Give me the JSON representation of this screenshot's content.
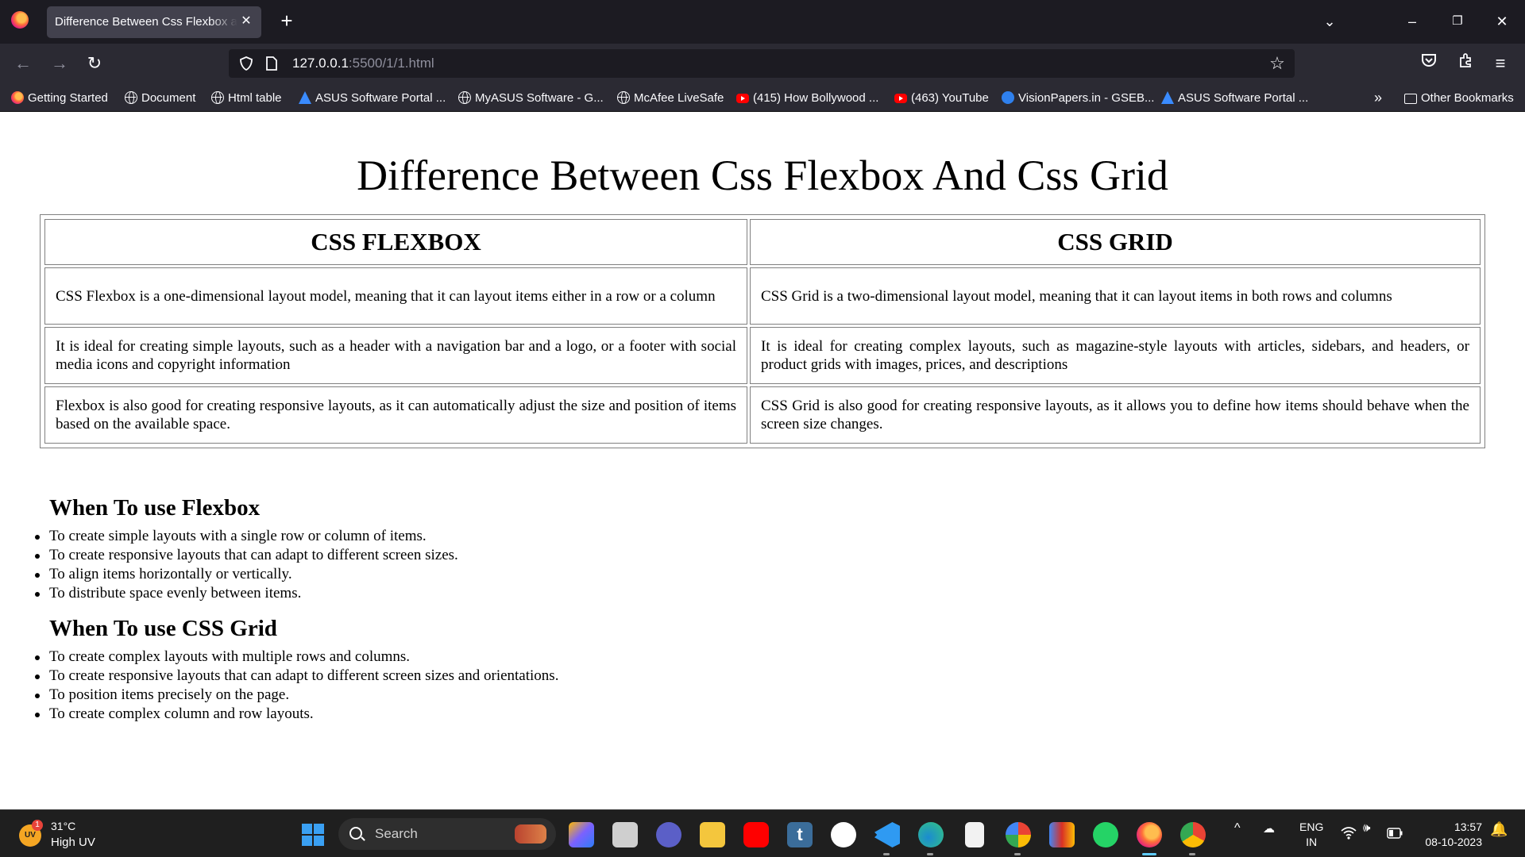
{
  "browser": {
    "tab_title": "Difference Between Css Flexbox and Css Grid",
    "url_host": "127.0.0.1",
    "url_rest": ":5500/1/1.html",
    "bookmarks": [
      {
        "label": "Getting Started",
        "icon": "firefox-icon"
      },
      {
        "label": "Document",
        "icon": "globe-icon"
      },
      {
        "label": "Html table",
        "icon": "globe-icon"
      },
      {
        "label": "ASUS Software Portal ...",
        "icon": "asus-icon"
      },
      {
        "label": "MyASUS Software - G...",
        "icon": "globe-icon"
      },
      {
        "label": "McAfee LiveSafe",
        "icon": "globe-icon"
      },
      {
        "label": "(415) How Bollywood ...",
        "icon": "youtube-icon"
      },
      {
        "label": "(463) YouTube",
        "icon": "youtube-icon"
      },
      {
        "label": "VisionPapers.in - GSEB...",
        "icon": "visionpapers-icon"
      },
      {
        "label": "ASUS Software Portal ...",
        "icon": "asus-icon"
      }
    ],
    "other_bookmarks": "Other Bookmarks"
  },
  "page": {
    "title": "Difference Between Css Flexbox And Css Grid",
    "table": {
      "headers": [
        "CSS FLEXBOX",
        "CSS GRID"
      ],
      "rows": [
        [
          "CSS Flexbox is a one-dimensional layout model, meaning that it can layout items either in a row or a column",
          "CSS Grid is a two-dimensional layout model, meaning that it can layout items in both rows and columns"
        ],
        [
          "It is ideal for creating simple layouts, such as a header with a navigation bar and a logo, or a footer with social media icons and copyright information",
          "It is ideal for creating complex layouts, such as magazine-style layouts with articles, sidebars, and headers, or product grids with images, prices, and descriptions"
        ],
        [
          "Flexbox is also good for creating responsive layouts, as it can automatically adjust the size and position of items based on the available space.",
          "CSS Grid is also good for creating responsive layouts, as it allows you to define how items should behave when the screen size changes."
        ]
      ]
    },
    "flex_section": {
      "heading": "When To use Flexbox",
      "items": [
        "To create simple layouts with a single row or column of items.",
        "To create responsive layouts that can adapt to different screen sizes.",
        "To align items horizontally or vertically.",
        "To distribute space evenly between items."
      ]
    },
    "grid_section": {
      "heading": "When To use CSS Grid",
      "items": [
        "To create complex layouts with multiple rows and columns.",
        "To create responsive layouts that can adapt to different screen sizes and orientations.",
        "To position items precisely on the page.",
        "To create complex column and row layouts."
      ]
    }
  },
  "taskbar": {
    "weather_temp": "31°C",
    "weather_desc": "High UV",
    "weather_badge": "1",
    "weather_icon_text": "UV",
    "search_placeholder": "Search",
    "lang_line1": "ENG",
    "lang_line2": "IN",
    "time": "13:57",
    "date": "08-10-2023",
    "apps": [
      {
        "name": "start-icon",
        "color": "#3aa0f3"
      },
      {
        "name": "copilot-icon",
        "color": "#7b61ff"
      },
      {
        "name": "task-view-icon",
        "color": "#cfcfcf"
      },
      {
        "name": "meet-icon",
        "color": "#5b5fc7"
      },
      {
        "name": "file-explorer-icon",
        "color": "#f4c63d"
      },
      {
        "name": "youtube-app-icon",
        "color": "#ff0000"
      },
      {
        "name": "tumblr-icon",
        "color": "#3b6d9a"
      },
      {
        "name": "uplay-icon",
        "color": "#ffffff"
      },
      {
        "name": "vscode-icon",
        "color": "#2f9af2"
      },
      {
        "name": "edge-icon",
        "color": "#19a3c9"
      },
      {
        "name": "notepad-icon",
        "color": "#f2f2f2"
      },
      {
        "name": "google-icon",
        "color": "#ea4335"
      },
      {
        "name": "gmail-icon",
        "color": "#d93025"
      },
      {
        "name": "whatsapp-icon",
        "color": "#25d366"
      },
      {
        "name": "firefox-app-icon",
        "color": "#ff7139"
      },
      {
        "name": "chrome-icon",
        "color": "#34a853"
      }
    ]
  }
}
